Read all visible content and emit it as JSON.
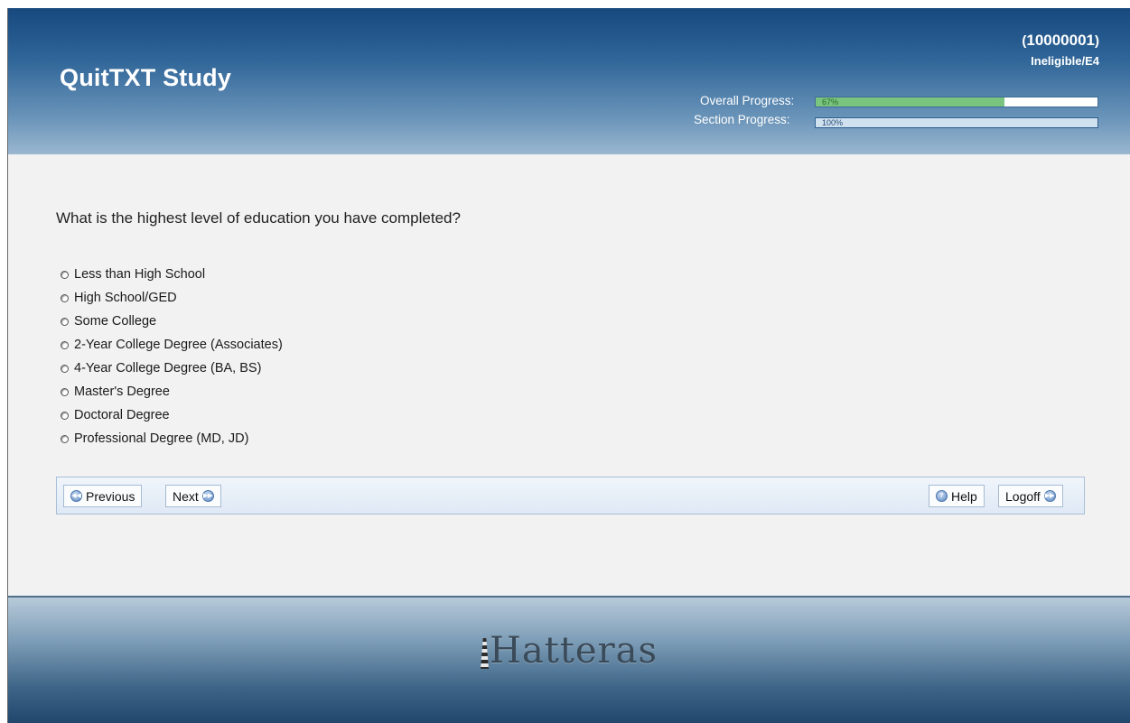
{
  "header": {
    "title": "QuitTXT Study",
    "participant_id": "10000001",
    "status": "Ineligible/E4",
    "overall_label": "Overall Progress:",
    "overall_pct_text": "67%",
    "overall_value": 0.67,
    "section_label": "Section Progress:",
    "section_pct_text": "100%",
    "section_value": 1.0
  },
  "question": {
    "text": "What is the highest level of education you have completed?",
    "options": [
      "Less than High School",
      "High School/GED",
      "Some College",
      "2-Year College Degree (Associates)",
      "4-Year College Degree (BA, BS)",
      "Master's Degree",
      "Doctoral Degree",
      "Professional Degree (MD, JD)"
    ]
  },
  "nav": {
    "previous": "Previous",
    "next": "Next",
    "help": "Help",
    "logoff": "Logoff"
  },
  "footer": {
    "logo_text": "Hatteras"
  },
  "icons": {
    "previous": "rewind-circle-icon",
    "next": "fast-forward-circle-icon",
    "help": "help-circle-icon",
    "logoff": "fast-forward-circle-icon",
    "logo": "lighthouse-icon"
  },
  "colors": {
    "header_top": "#17497e",
    "overall_fill": "#79c47f",
    "nav_bg": "#dfe9f5"
  }
}
